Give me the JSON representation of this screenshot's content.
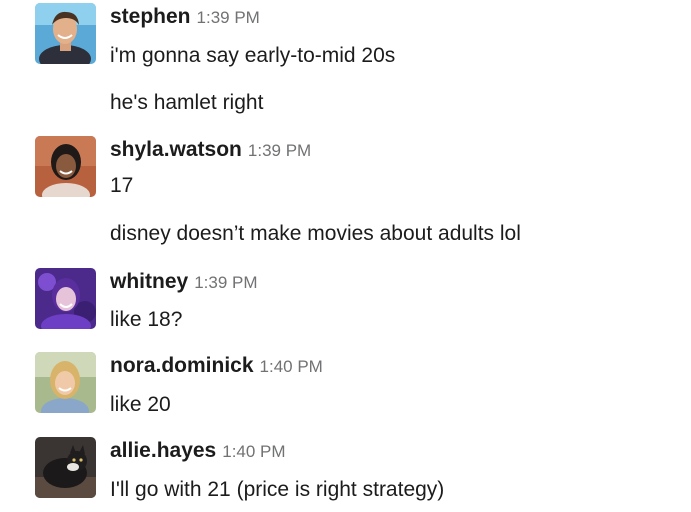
{
  "messages": [
    {
      "username": "stephen",
      "time": "1:39 PM",
      "lines": [
        "i'm gonna say early-to-mid 20s",
        "he's hamlet right"
      ]
    },
    {
      "username": "shyla.watson",
      "time": "1:39 PM",
      "lines": [
        "17",
        "disney doesn’t make movies about adults lol"
      ]
    },
    {
      "username": "whitney",
      "time": "1:39 PM",
      "lines": [
        "like 18?"
      ]
    },
    {
      "username": "nora.dominick",
      "time": "1:40 PM",
      "lines": [
        "like 20"
      ]
    },
    {
      "username": "allie.hayes",
      "time": "1:40 PM",
      "lines": [
        "I'll go with 21 (price is right strategy)"
      ]
    }
  ]
}
